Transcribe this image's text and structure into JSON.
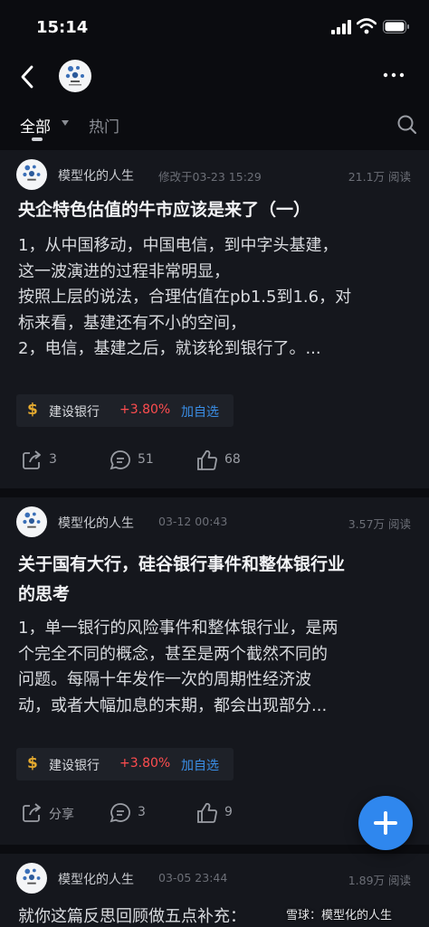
{
  "status_bar": {
    "time": "15:14"
  },
  "tabs": {
    "all": "全部",
    "hot": "热门"
  },
  "posts": [
    {
      "author": "模型化的人生",
      "time": "修改于03-23 15:29",
      "views": "21.1万 阅读",
      "title": "央企特色估值的牛市应该是来了（一）",
      "body_lines": [
        "1，从中国移动，中国电信，到中字头基建，",
        "这一波演进的过程非常明显，",
        "按照上层的说法，合理估值在pb1.5到1.6，对",
        "标来看，基建还有不小的空间，",
        "2，电信，基建之后，就该轮到银行了。..."
      ],
      "stock": {
        "symbol": "$",
        "name": "建设银行",
        "change": "+3.80%",
        "add": "加自选"
      },
      "share": "3",
      "comments": "51",
      "likes": "68"
    },
    {
      "author": "模型化的人生",
      "time": "03-12 00:43",
      "views": "3.57万 阅读",
      "title_lines": [
        "关于国有大行，硅谷银行事件和整体银行业",
        "的思考"
      ],
      "body_lines": [
        "1，单一银行的风险事件和整体银行业，是两",
        "个完全不同的概念，甚至是两个截然不同的",
        "问题。每隔十年发作一次的周期性经济波",
        "动，或者大幅加息的末期，都会出现部分..."
      ],
      "stock": {
        "symbol": "$",
        "name": "建设银行",
        "change": "+3.80%",
        "add": "加自选"
      },
      "share": "分享",
      "comments": "3",
      "likes": "9"
    },
    {
      "author": "模型化的人生",
      "time": "03-05 23:44",
      "views": "1.89万 阅读",
      "body_partial": "就你这篇反思回顾做五点补充："
    }
  ],
  "watermark": "雪球：模型化的人生",
  "colors": {
    "background": "#0b0c10",
    "card": "#15171d",
    "accent": "#2f87ee",
    "up": "#ff4d4f",
    "link": "#3a8ee6"
  }
}
